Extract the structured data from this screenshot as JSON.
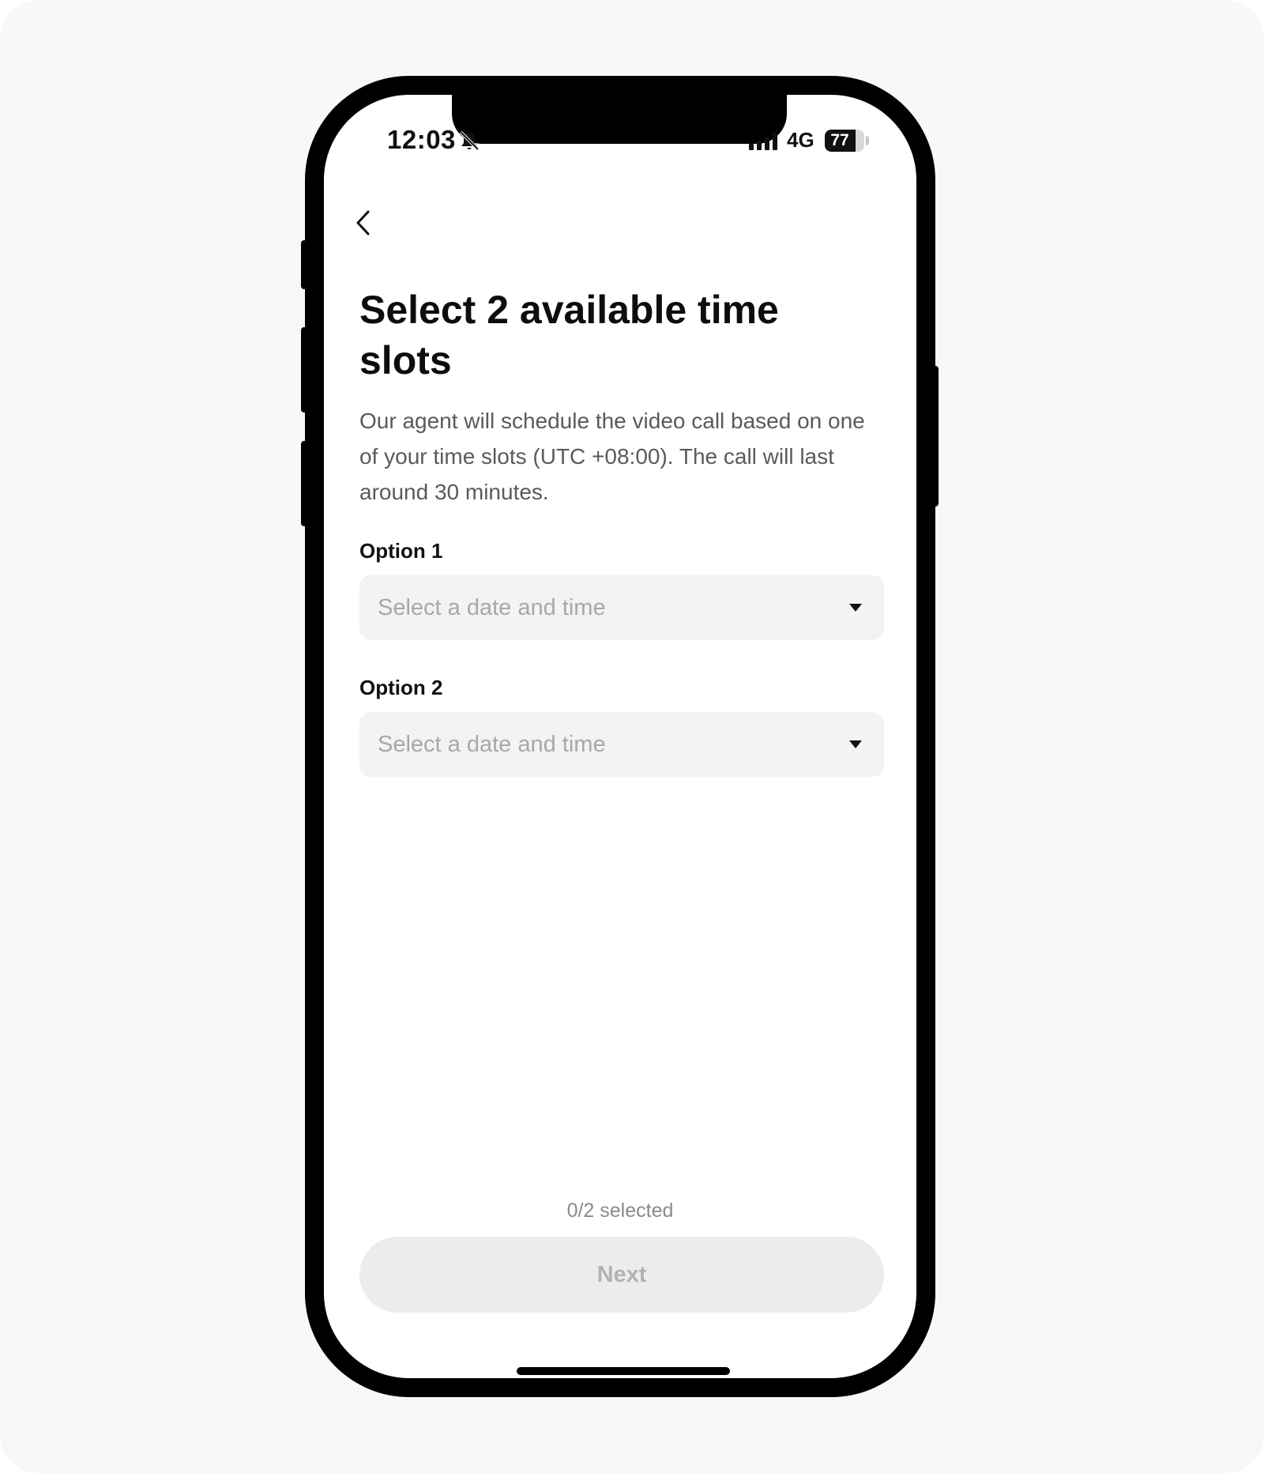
{
  "status_bar": {
    "time": "12:03",
    "network": "4G",
    "battery_percent": "77",
    "battery_level": 0.77
  },
  "header": {
    "title": "Select 2 available time slots",
    "description": "Our agent will schedule the video call based on one of your time slots (UTC +08:00). The call will last around 30 minutes."
  },
  "options": [
    {
      "label": "Option 1",
      "placeholder": "Select a date and time"
    },
    {
      "label": "Option 2",
      "placeholder": "Select a date and time"
    }
  ],
  "footer": {
    "selected_count": "0/2 selected",
    "next_label": "Next",
    "next_enabled": false
  }
}
